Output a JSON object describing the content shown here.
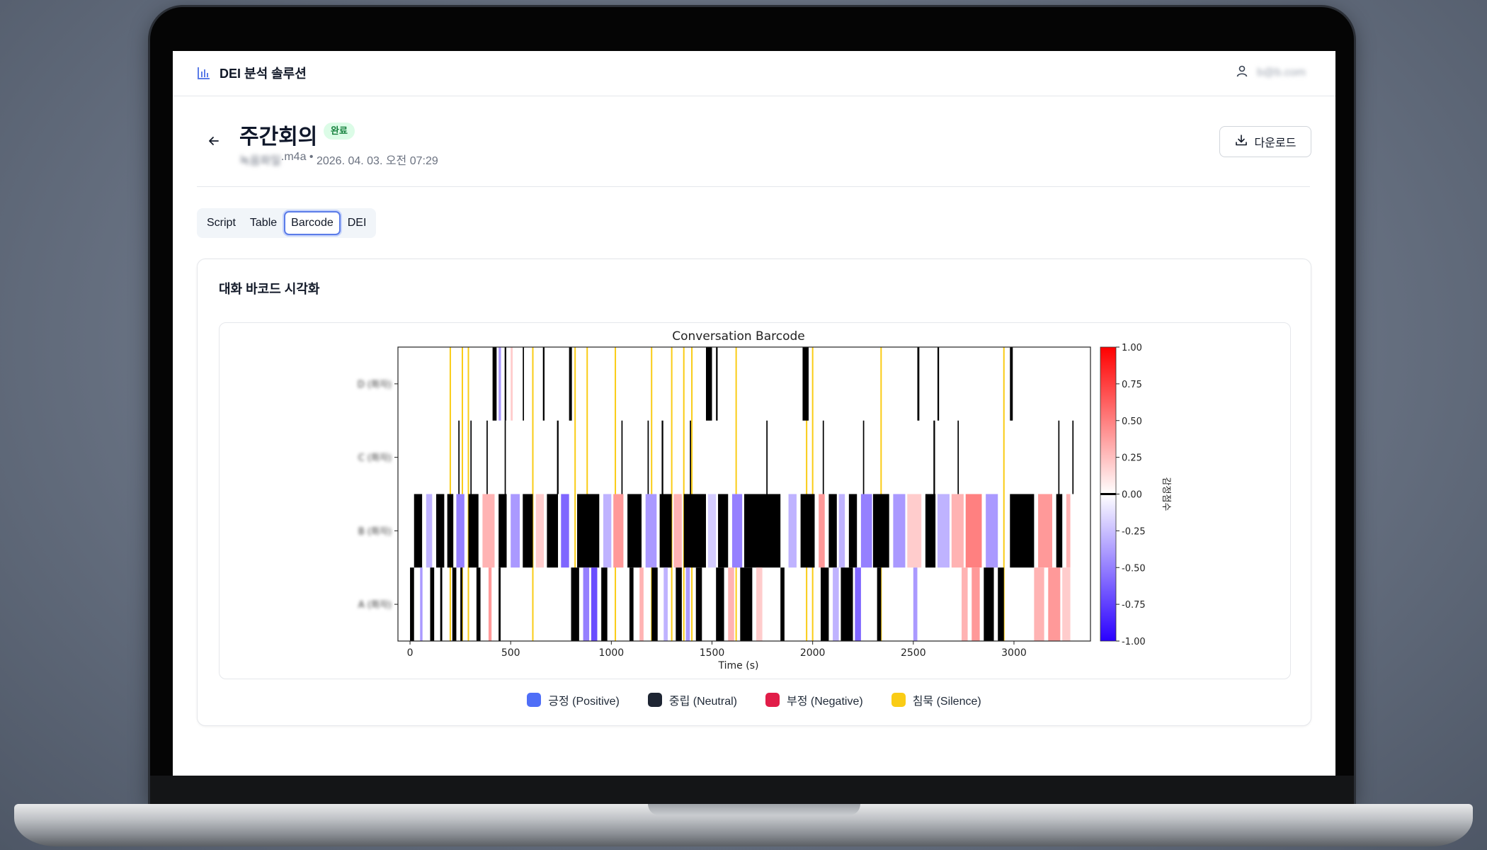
{
  "app": {
    "title": "DEI 분석 솔루션",
    "user_email": "b@b.com"
  },
  "meeting": {
    "title": "주간회의",
    "status": "완료",
    "file_name": "녹음파일",
    "file_ext": ".m4a",
    "separator": " • ",
    "datetime": "2026. 04. 03. 오전 07:29"
  },
  "actions": {
    "download_label": "다운로드"
  },
  "tabs": [
    {
      "label": "Script"
    },
    {
      "label": "Table"
    },
    {
      "label": "Barcode",
      "active": true
    },
    {
      "label": "DEI"
    }
  ],
  "section": {
    "title": "대화 바코드 시각화"
  },
  "colors": {
    "positive": "#4f6ef7",
    "neutral": "#1e2533",
    "negative": "#e11d48",
    "silence": "#facc15",
    "accent": "#5b7ce8"
  },
  "legend": [
    {
      "label": "긍정 (Positive)",
      "color": "#4f6ef7"
    },
    {
      "label": "중립 (Neutral)",
      "color": "#1e2533"
    },
    {
      "label": "부정 (Negative)",
      "color": "#e11d48"
    },
    {
      "label": "침묵 (Silence)",
      "color": "#facc15"
    }
  ],
  "chart_data": {
    "type": "heatmap",
    "title": "Conversation Barcode",
    "xlabel": "Time (s)",
    "ylabel": "",
    "xlim": [
      -60,
      3380
    ],
    "xticks": [
      0,
      500,
      1000,
      1500,
      2000,
      2500,
      3000
    ],
    "xtick_labels": [
      "0",
      "500",
      "1000",
      "1500",
      "2000",
      "2500",
      "3000"
    ],
    "grid": false,
    "speakers": [
      "D (화자)",
      "C (화자)",
      "B (화자)",
      "A (화자)"
    ],
    "colorbar": {
      "label": "감정점수",
      "range": [
        -1.0,
        1.0
      ],
      "ticks": [
        1.0,
        0.75,
        0.5,
        0.25,
        0.0,
        -0.25,
        -0.5,
        -0.75,
        -1.0
      ],
      "tick_labels": [
        "1.00",
        "0.75",
        "0.50",
        "0.25",
        "0.00",
        "-0.25",
        "-0.50",
        "-0.75",
        "-1.00"
      ]
    },
    "silence_times": [
      200,
      260,
      290,
      610,
      820,
      880,
      1020,
      1200,
      1300,
      1360,
      1400,
      1620,
      1970,
      2000,
      2340,
      2950
    ],
    "segments": [
      {
        "speaker": 0,
        "t": 410,
        "d": 20,
        "s": 0.0
      },
      {
        "speaker": 0,
        "t": 440,
        "d": 12,
        "s": -0.4
      },
      {
        "speaker": 0,
        "t": 470,
        "d": 8,
        "s": 0.0
      },
      {
        "speaker": 0,
        "t": 500,
        "d": 10,
        "s": 0.2
      },
      {
        "speaker": 0,
        "t": 560,
        "d": 6,
        "s": 0.0
      },
      {
        "speaker": 0,
        "t": 660,
        "d": 8,
        "s": 0.0
      },
      {
        "speaker": 0,
        "t": 790,
        "d": 14,
        "s": 0.0
      },
      {
        "speaker": 0,
        "t": 1470,
        "d": 30,
        "s": 0.0
      },
      {
        "speaker": 0,
        "t": 1520,
        "d": 8,
        "s": 0.0
      },
      {
        "speaker": 0,
        "t": 1950,
        "d": 30,
        "s": 0.0
      },
      {
        "speaker": 0,
        "t": 2520,
        "d": 10,
        "s": 0.0
      },
      {
        "speaker": 0,
        "t": 2620,
        "d": 8,
        "s": 0.0
      },
      {
        "speaker": 0,
        "t": 2980,
        "d": 14,
        "s": 0.0
      },
      {
        "speaker": 1,
        "t": 240,
        "d": 6,
        "s": 0.0
      },
      {
        "speaker": 1,
        "t": 300,
        "d": 6,
        "s": 0.0
      },
      {
        "speaker": 1,
        "t": 380,
        "d": 6,
        "s": 0.0
      },
      {
        "speaker": 1,
        "t": 470,
        "d": 6,
        "s": 0.0
      },
      {
        "speaker": 1,
        "t": 730,
        "d": 8,
        "s": 0.0
      },
      {
        "speaker": 1,
        "t": 1050,
        "d": 6,
        "s": 0.0
      },
      {
        "speaker": 1,
        "t": 1180,
        "d": 6,
        "s": 0.0
      },
      {
        "speaker": 1,
        "t": 1250,
        "d": 8,
        "s": 0.0
      },
      {
        "speaker": 1,
        "t": 1390,
        "d": 6,
        "s": 0.0
      },
      {
        "speaker": 1,
        "t": 1770,
        "d": 6,
        "s": 0.0
      },
      {
        "speaker": 1,
        "t": 2050,
        "d": 6,
        "s": 0.0
      },
      {
        "speaker": 1,
        "t": 2250,
        "d": 6,
        "s": 0.0
      },
      {
        "speaker": 1,
        "t": 2600,
        "d": 8,
        "s": 0.0
      },
      {
        "speaker": 1,
        "t": 2720,
        "d": 6,
        "s": 0.0
      },
      {
        "speaker": 1,
        "t": 3220,
        "d": 6,
        "s": 0.0
      },
      {
        "speaker": 1,
        "t": 3290,
        "d": 6,
        "s": 0.0
      },
      {
        "speaker": 2,
        "t": 20,
        "d": 40,
        "s": 0.0
      },
      {
        "speaker": 2,
        "t": 80,
        "d": 30,
        "s": -0.3
      },
      {
        "speaker": 2,
        "t": 130,
        "d": 40,
        "s": 0.0
      },
      {
        "speaker": 2,
        "t": 185,
        "d": 30,
        "s": 0.0
      },
      {
        "speaker": 2,
        "t": 230,
        "d": 40,
        "s": -0.5
      },
      {
        "speaker": 2,
        "t": 290,
        "d": 50,
        "s": 0.0
      },
      {
        "speaker": 2,
        "t": 360,
        "d": 60,
        "s": 0.3
      },
      {
        "speaker": 2,
        "t": 440,
        "d": 40,
        "s": 0.0
      },
      {
        "speaker": 2,
        "t": 500,
        "d": 45,
        "s": -0.4
      },
      {
        "speaker": 2,
        "t": 560,
        "d": 50,
        "s": 0.0
      },
      {
        "speaker": 2,
        "t": 625,
        "d": 40,
        "s": 0.2
      },
      {
        "speaker": 2,
        "t": 680,
        "d": 55,
        "s": 0.0
      },
      {
        "speaker": 2,
        "t": 750,
        "d": 40,
        "s": -0.6
      },
      {
        "speaker": 2,
        "t": 830,
        "d": 110,
        "s": 0.0
      },
      {
        "speaker": 2,
        "t": 960,
        "d": 40,
        "s": -0.3
      },
      {
        "speaker": 2,
        "t": 1010,
        "d": 50,
        "s": 0.4
      },
      {
        "speaker": 2,
        "t": 1080,
        "d": 70,
        "s": 0.0
      },
      {
        "speaker": 2,
        "t": 1170,
        "d": 55,
        "s": -0.4
      },
      {
        "speaker": 2,
        "t": 1240,
        "d": 60,
        "s": 0.0
      },
      {
        "speaker": 2,
        "t": 1310,
        "d": 40,
        "s": 0.3
      },
      {
        "speaker": 2,
        "t": 1360,
        "d": 110,
        "s": 0.0
      },
      {
        "speaker": 2,
        "t": 1480,
        "d": 40,
        "s": -0.2
      },
      {
        "speaker": 2,
        "t": 1530,
        "d": 50,
        "s": 0.0
      },
      {
        "speaker": 2,
        "t": 1600,
        "d": 50,
        "s": -0.5
      },
      {
        "speaker": 2,
        "t": 1660,
        "d": 180,
        "s": 0.0
      },
      {
        "speaker": 2,
        "t": 1880,
        "d": 40,
        "s": -0.3
      },
      {
        "speaker": 2,
        "t": 1940,
        "d": 70,
        "s": 0.0
      },
      {
        "speaker": 2,
        "t": 2030,
        "d": 30,
        "s": 0.4
      },
      {
        "speaker": 2,
        "t": 2080,
        "d": 40,
        "s": 0.0
      },
      {
        "speaker": 2,
        "t": 2130,
        "d": 30,
        "s": -0.3
      },
      {
        "speaker": 2,
        "t": 2180,
        "d": 40,
        "s": 0.0
      },
      {
        "speaker": 2,
        "t": 2240,
        "d": 55,
        "s": -0.5
      },
      {
        "speaker": 2,
        "t": 2300,
        "d": 80,
        "s": 0.0
      },
      {
        "speaker": 2,
        "t": 2400,
        "d": 60,
        "s": -0.4
      },
      {
        "speaker": 2,
        "t": 2470,
        "d": 70,
        "s": 0.2
      },
      {
        "speaker": 2,
        "t": 2560,
        "d": 50,
        "s": 0.0
      },
      {
        "speaker": 2,
        "t": 2620,
        "d": 60,
        "s": -0.3
      },
      {
        "speaker": 2,
        "t": 2690,
        "d": 60,
        "s": 0.3
      },
      {
        "speaker": 2,
        "t": 2760,
        "d": 80,
        "s": 0.5
      },
      {
        "speaker": 2,
        "t": 2860,
        "d": 60,
        "s": -0.4
      },
      {
        "speaker": 2,
        "t": 2980,
        "d": 120,
        "s": 0.0
      },
      {
        "speaker": 2,
        "t": 3120,
        "d": 70,
        "s": 0.4
      },
      {
        "speaker": 2,
        "t": 3210,
        "d": 30,
        "s": 0.0
      },
      {
        "speaker": 2,
        "t": 3260,
        "d": 20,
        "s": 0.3
      },
      {
        "speaker": 3,
        "t": 0,
        "d": 20,
        "s": 0.0
      },
      {
        "speaker": 3,
        "t": 50,
        "d": 12,
        "s": -0.4
      },
      {
        "speaker": 3,
        "t": 100,
        "d": 20,
        "s": 0.0
      },
      {
        "speaker": 3,
        "t": 150,
        "d": 10,
        "s": 0.0
      },
      {
        "speaker": 3,
        "t": 210,
        "d": 20,
        "s": 0.0
      },
      {
        "speaker": 3,
        "t": 250,
        "d": 10,
        "s": 0.0
      },
      {
        "speaker": 3,
        "t": 330,
        "d": 20,
        "s": 0.0
      },
      {
        "speaker": 3,
        "t": 390,
        "d": 15,
        "s": 0.4
      },
      {
        "speaker": 3,
        "t": 440,
        "d": 10,
        "s": 0.0
      },
      {
        "speaker": 3,
        "t": 800,
        "d": 40,
        "s": 0.0
      },
      {
        "speaker": 3,
        "t": 860,
        "d": 30,
        "s": -0.5
      },
      {
        "speaker": 3,
        "t": 900,
        "d": 30,
        "s": -0.7
      },
      {
        "speaker": 3,
        "t": 950,
        "d": 30,
        "s": 0.0
      },
      {
        "speaker": 3,
        "t": 1090,
        "d": 20,
        "s": 0.0
      },
      {
        "speaker": 3,
        "t": 1140,
        "d": 20,
        "s": 0.3
      },
      {
        "speaker": 3,
        "t": 1200,
        "d": 30,
        "s": 0.0
      },
      {
        "speaker": 3,
        "t": 1260,
        "d": 20,
        "s": -0.3
      },
      {
        "speaker": 3,
        "t": 1320,
        "d": 30,
        "s": 0.0
      },
      {
        "speaker": 3,
        "t": 1370,
        "d": 20,
        "s": -0.4
      },
      {
        "speaker": 3,
        "t": 1420,
        "d": 30,
        "s": 0.0
      },
      {
        "speaker": 3,
        "t": 1520,
        "d": 40,
        "s": 0.0
      },
      {
        "speaker": 3,
        "t": 1580,
        "d": 30,
        "s": 0.3
      },
      {
        "speaker": 3,
        "t": 1640,
        "d": 60,
        "s": 0.0
      },
      {
        "speaker": 3,
        "t": 1720,
        "d": 30,
        "s": 0.2
      },
      {
        "speaker": 3,
        "t": 1840,
        "d": 20,
        "s": 0.0
      },
      {
        "speaker": 3,
        "t": 2040,
        "d": 40,
        "s": 0.0
      },
      {
        "speaker": 3,
        "t": 2100,
        "d": 30,
        "s": -0.3
      },
      {
        "speaker": 3,
        "t": 2140,
        "d": 60,
        "s": 0.0
      },
      {
        "speaker": 3,
        "t": 2210,
        "d": 30,
        "s": -0.6
      },
      {
        "speaker": 3,
        "t": 2320,
        "d": 20,
        "s": 0.0
      },
      {
        "speaker": 3,
        "t": 2500,
        "d": 20,
        "s": -0.4
      },
      {
        "speaker": 3,
        "t": 2740,
        "d": 30,
        "s": 0.3
      },
      {
        "speaker": 3,
        "t": 2790,
        "d": 40,
        "s": 0.4
      },
      {
        "speaker": 3,
        "t": 2850,
        "d": 50,
        "s": 0.0
      },
      {
        "speaker": 3,
        "t": 2920,
        "d": 30,
        "s": 0.0
      },
      {
        "speaker": 3,
        "t": 3100,
        "d": 50,
        "s": 0.3
      },
      {
        "speaker": 3,
        "t": 3170,
        "d": 60,
        "s": 0.4
      },
      {
        "speaker": 3,
        "t": 3240,
        "d": 40,
        "s": 0.2
      }
    ]
  }
}
